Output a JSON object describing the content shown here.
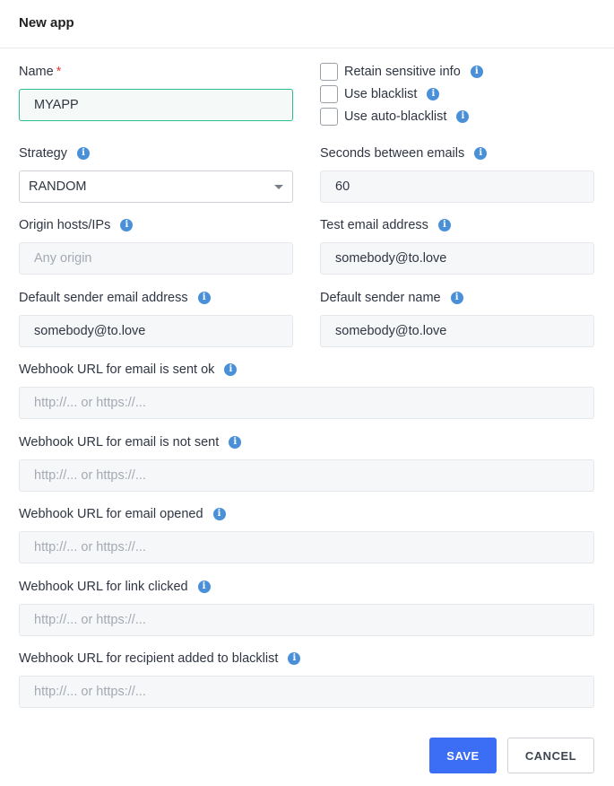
{
  "dialog": {
    "title": "New app"
  },
  "fields": {
    "name": {
      "label": "Name",
      "required_mark": "*",
      "value": "MYAPP"
    },
    "strategy": {
      "label": "Strategy",
      "value": "RANDOM"
    },
    "origin": {
      "label": "Origin hosts/IPs",
      "placeholder": "Any origin"
    },
    "default_sender_email": {
      "label": "Default sender email address",
      "value": "somebody@to.love"
    },
    "seconds_between": {
      "label": "Seconds between emails",
      "value": "60"
    },
    "test_email": {
      "label": "Test email address",
      "value": "somebody@to.love"
    },
    "default_sender_name": {
      "label": "Default sender name",
      "value": "somebody@to.love"
    },
    "webhook_sent_ok": {
      "label": "Webhook URL for email is sent ok",
      "placeholder": "http://... or https://..."
    },
    "webhook_not_sent": {
      "label": "Webhook URL for email is not sent",
      "placeholder": "http://... or https://..."
    },
    "webhook_opened": {
      "label": "Webhook URL for email opened",
      "placeholder": "http://... or https://..."
    },
    "webhook_link_clicked": {
      "label": "Webhook URL for link clicked",
      "placeholder": "http://... or https://..."
    },
    "webhook_blacklist": {
      "label": "Webhook URL for recipient added to blacklist",
      "placeholder": "http://... or https://..."
    }
  },
  "checkboxes": {
    "retain_sensitive": {
      "label": "Retain sensitive info",
      "checked": false
    },
    "use_blacklist": {
      "label": "Use blacklist",
      "checked": false
    },
    "use_auto_blacklist": {
      "label": "Use auto-blacklist",
      "checked": false
    }
  },
  "icons": {
    "info": "i",
    "info_icon_name": "info-icon",
    "caret_icon_name": "chevron-down-icon"
  },
  "buttons": {
    "save": "SAVE",
    "cancel": "CANCEL"
  },
  "colors": {
    "primary": "#3b6ef5",
    "focus": "#2bbd8e",
    "info": "#4a90d9",
    "required": "#e53e3e"
  }
}
